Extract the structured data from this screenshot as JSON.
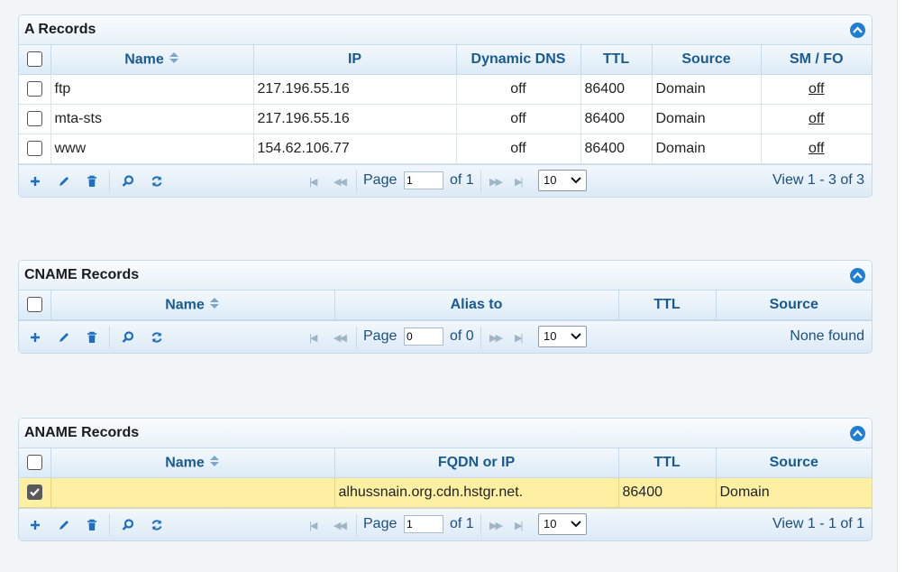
{
  "a_records": {
    "title": "A Records",
    "headers": [
      "Name",
      "IP",
      "Dynamic DNS",
      "TTL",
      "Source",
      "SM / FO"
    ],
    "rows": [
      {
        "name": "ftp",
        "ip": "217.196.55.16",
        "ddns": "off",
        "ttl": "86400",
        "source": "Domain",
        "smfo": "off"
      },
      {
        "name": "mta-sts",
        "ip": "217.196.55.16",
        "ddns": "off",
        "ttl": "86400",
        "source": "Domain",
        "smfo": "off"
      },
      {
        "name": "www",
        "ip": "154.62.106.77",
        "ddns": "off",
        "ttl": "86400",
        "source": "Domain",
        "smfo": "off"
      }
    ],
    "pager": {
      "page_label": "Page",
      "page_value": "1",
      "of_label": "of 1",
      "page_size": "10",
      "view_info": "View 1 - 3 of 3"
    }
  },
  "cname_records": {
    "title": "CNAME Records",
    "headers": [
      "Name",
      "Alias to",
      "TTL",
      "Source"
    ],
    "pager": {
      "page_label": "Page",
      "page_value": "0",
      "of_label": "of 0",
      "page_size": "10",
      "view_info": "None found"
    }
  },
  "aname_records": {
    "title": "ANAME Records",
    "headers": [
      "Name",
      "FQDN or IP",
      "TTL",
      "Source"
    ],
    "rows": [
      {
        "name": "",
        "fqdn": "alhussnain.org.cdn.hstgr.net.",
        "ttl": "86400",
        "source": "Domain",
        "checked": true
      }
    ],
    "pager": {
      "page_label": "Page",
      "page_value": "1",
      "of_label": "of 1",
      "page_size": "10",
      "view_info": "View 1 - 1 of 1"
    }
  },
  "icons": {
    "add": "plus-icon",
    "edit": "pencil-icon",
    "delete": "trash-icon",
    "search": "magnifier-icon",
    "refresh": "refresh-icon",
    "collapse": "collapse-up-icon",
    "sort": "sort-arrows-icon"
  },
  "colors": {
    "accent": "#1e7fd0",
    "header_text": "#1a5a93",
    "selected_row": "#fdf0a2"
  }
}
